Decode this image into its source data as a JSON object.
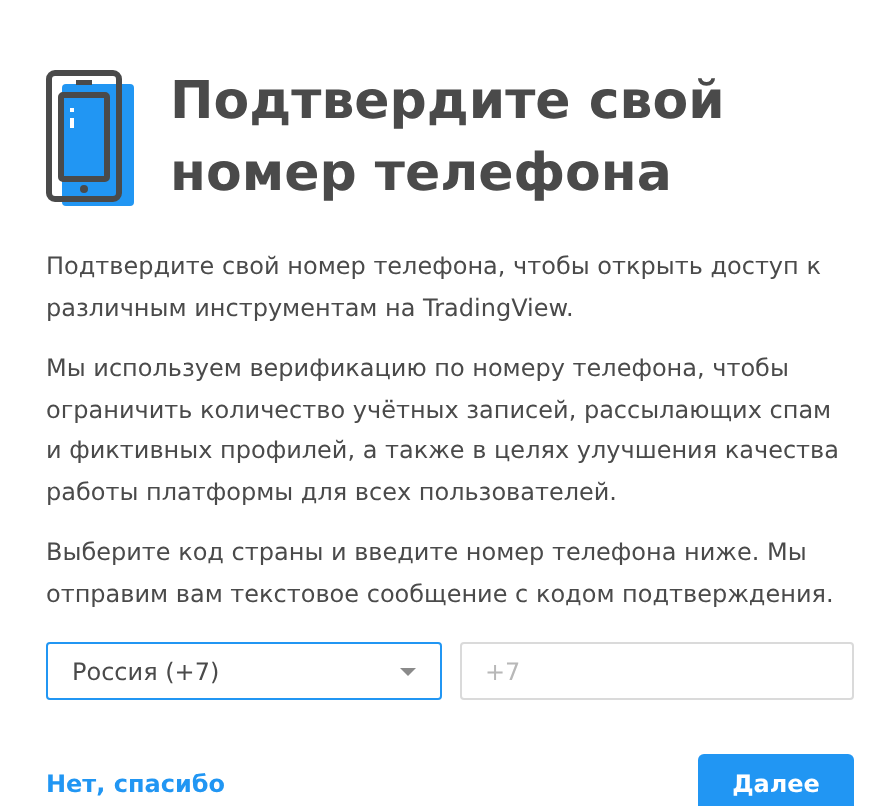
{
  "title": "Подтвердите свой номер телефона",
  "paragraphs": [
    "Подтвердите свой номер телефона, чтобы открыть доступ к различным инструментам на TradingView.",
    "Мы используем верификацию по номеру телефона, чтобы ограничить количество учётных записей, рассылающих спам и фиктивных профилей, а также в целях улучшения качества работы платформы для всех пользователей.",
    "Выберите код страны и введите номер телефона ниже. Мы отправим вам текстовое сообщение с кодом подтверждения."
  ],
  "country_select": {
    "value": "Россия (+7)"
  },
  "phone_field": {
    "placeholder": "+7"
  },
  "decline_link": "Нет, спасибо",
  "next_button": "Далее"
}
